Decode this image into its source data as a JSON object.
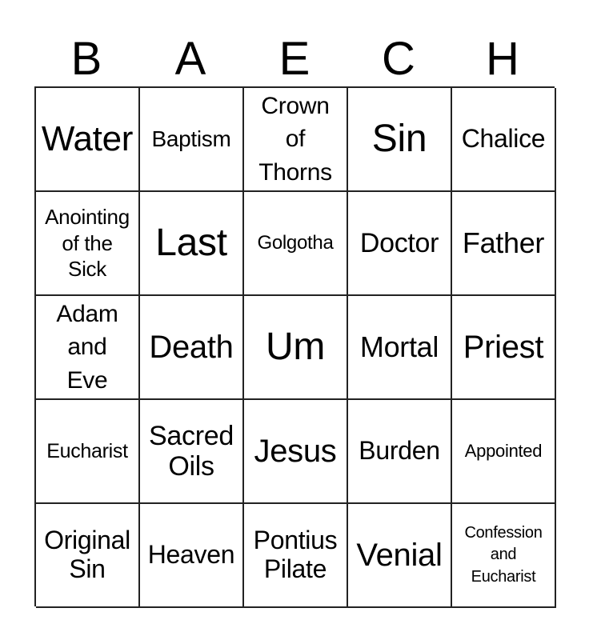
{
  "header": {
    "letters": [
      "B",
      "A",
      "E",
      "C",
      "H"
    ]
  },
  "card": {
    "rows": [
      [
        "Water",
        "Baptism",
        "Crown\nof\nThorns",
        "Sin",
        "Chalice"
      ],
      [
        "Anointing\nof the\nSick",
        "Last",
        "Golgotha",
        "Doctor",
        "Father"
      ],
      [
        "Adam\nand\nEve",
        "Death",
        "Um",
        "Mortal",
        "Priest"
      ],
      [
        "Eucharist",
        "Sacred\nOils",
        "Jesus",
        "Burden",
        "Appointed"
      ],
      [
        "Original\nSin",
        "Heaven",
        "Pontius\nPilate",
        "Venial",
        "Confession\nand\nEucharist"
      ]
    ]
  }
}
